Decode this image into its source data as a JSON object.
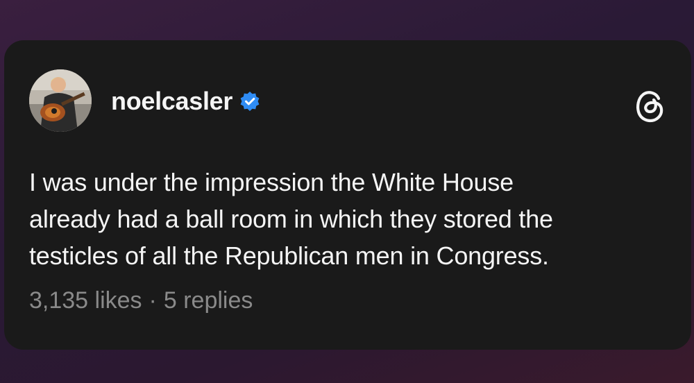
{
  "post": {
    "username": "noelcasler",
    "verified": true,
    "lines": [
      "I was under the impression the White House",
      "already had a ball room in which they stored the",
      "testicles of all the Republican men in Congress."
    ],
    "likes": "3,135 likes",
    "separator": "·",
    "replies": "5 replies"
  },
  "icons": {
    "verified_badge": "verified-badge-icon",
    "app_logo": "threads-logo-icon"
  },
  "colors": {
    "card_background": "#1a1a1a",
    "text": "#f5f5f5",
    "muted_text": "#8a8a8a",
    "verified_blue": "#2f8cf4"
  }
}
